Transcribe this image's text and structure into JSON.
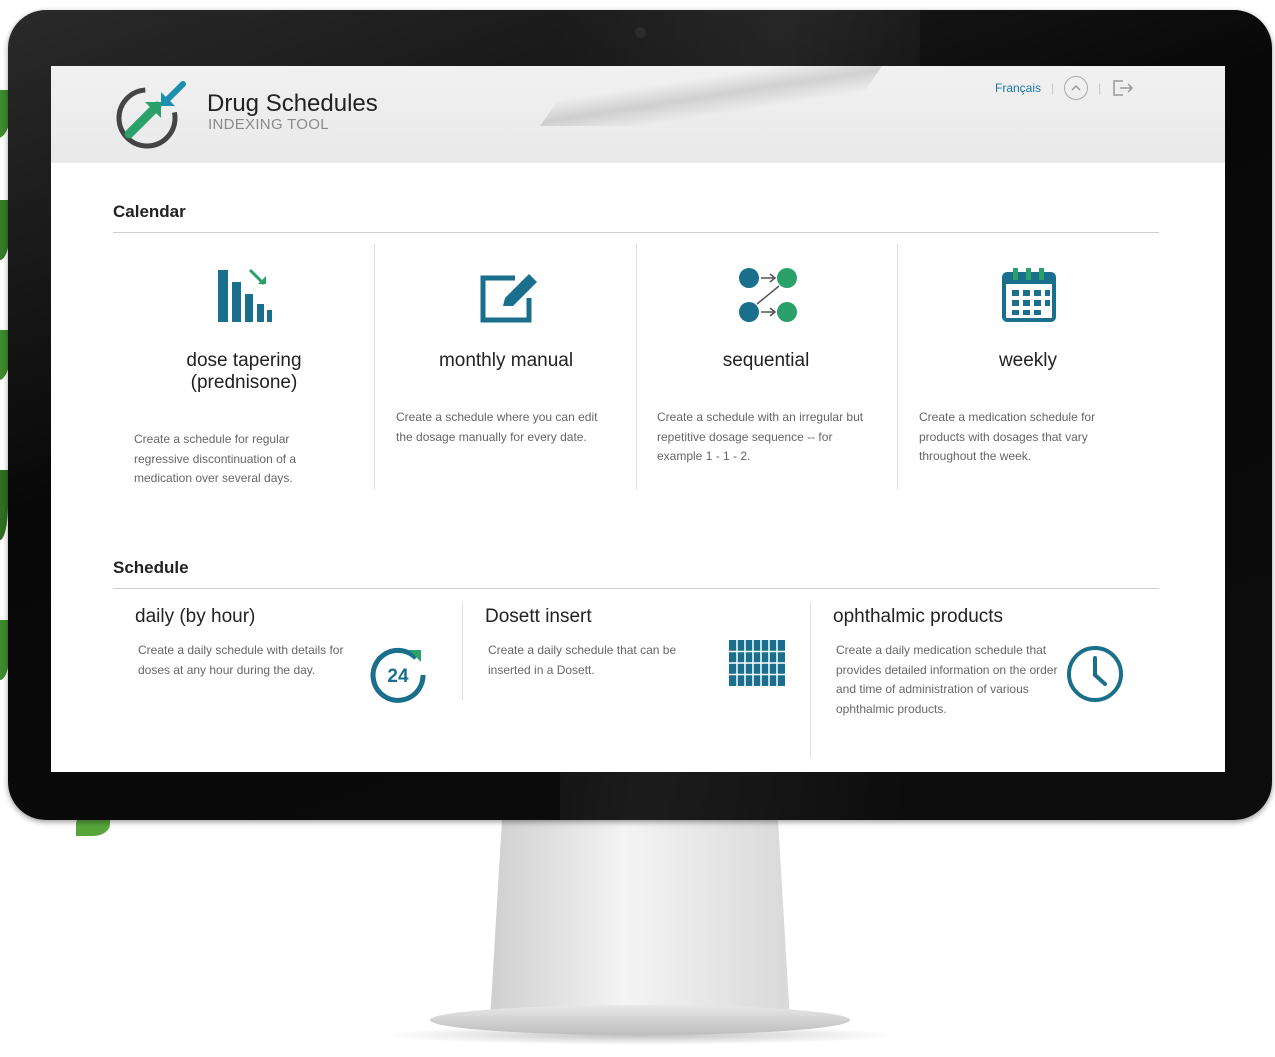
{
  "app": {
    "title": "Drug Schedules",
    "subtitle": "INDEXING TOOL"
  },
  "topbar": {
    "language_link": "Français"
  },
  "calendar": {
    "heading": "Calendar",
    "cards": [
      {
        "icon": "bar-chart-tapering-icon",
        "title": "dose tapering (prednisone)",
        "description": "Create a schedule for regular regressive discontinuation of a medication over several days."
      },
      {
        "icon": "edit-pencil-icon",
        "title": "monthly manual",
        "description": "Create a schedule where you can edit the dosage manually for every date."
      },
      {
        "icon": "sequence-nodes-icon",
        "title": "sequential",
        "description": "Create a schedule with an irregular but repetitive dosage sequence -- for example 1 - 1 - 2."
      },
      {
        "icon": "calendar-icon",
        "title": "weekly",
        "description": "Create a medication schedule for products with dosages that vary throughout the week."
      }
    ]
  },
  "schedule": {
    "heading": "Schedule",
    "cards": [
      {
        "icon": "24-hour-icon",
        "title": "daily (by hour)",
        "description": "Create a daily schedule with details for doses at any hour during the day."
      },
      {
        "icon": "dosett-grid-icon",
        "title": "Dosett insert",
        "description": "Create a daily schedule that can be inserted in a Dosett."
      },
      {
        "icon": "clock-icon",
        "title": "ophthalmic products",
        "description": "Create a daily medication schedule that provides detailed information on the order and time of administration of various ophthalmic products."
      }
    ]
  },
  "colors": {
    "accent": "#1a6f8c",
    "accent_green": "#2aa06a",
    "link": "#1a78a8"
  }
}
